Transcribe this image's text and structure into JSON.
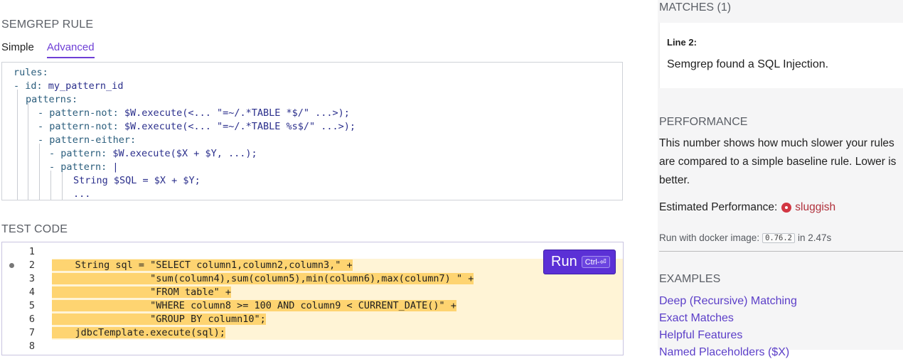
{
  "rule_section": {
    "title": "SEMGREP RULE",
    "tabs": [
      {
        "label": "Simple",
        "active": false
      },
      {
        "label": "Advanced",
        "active": true
      }
    ],
    "yaml_lines": [
      {
        "key": "rules:",
        "val": ""
      },
      {
        "key": "- id: ",
        "val": "my_pattern_id"
      },
      {
        "key": "patterns:",
        "val": ""
      },
      {
        "key": "- pattern-not: ",
        "val": "$W.execute(<... \"=~/.*TABLE *$/\" ...>);"
      },
      {
        "key": "- pattern-not: ",
        "val": "$W.execute(<... \"=~/.*TABLE %s$/\" ...>);"
      },
      {
        "key": "- pattern-either:",
        "val": ""
      },
      {
        "key": "- pattern: ",
        "val": "$W.execute($X + $Y, ...);"
      },
      {
        "key": "- pattern: ",
        "val": "|"
      },
      {
        "key": "",
        "val": "String $SQL = $X + $Y;"
      },
      {
        "key": "",
        "val": "..."
      }
    ]
  },
  "test_section": {
    "title": "TEST CODE",
    "run_button": {
      "label": "Run",
      "shortcut": "Ctrl-⏎"
    },
    "lines": [
      {
        "num": "1",
        "code": "",
        "highlight": false,
        "dot": false
      },
      {
        "num": "2",
        "code": "    String sql = \"SELECT column1,column2,column3,\" +",
        "highlight": true,
        "dot": true
      },
      {
        "num": "3",
        "code": "                 \"sum(column4),sum(column5),min(column6),max(column7) \" +",
        "highlight": true,
        "dot": false
      },
      {
        "num": "4",
        "code": "                 \"FROM table\" +",
        "highlight": true,
        "dot": false
      },
      {
        "num": "5",
        "code": "                 \"WHERE column8 >= 100 AND column9 < CURRENT_DATE()\" +",
        "highlight": true,
        "dot": false
      },
      {
        "num": "6",
        "code": "                 \"GROUP BY column10\";",
        "highlight": true,
        "dot": false
      },
      {
        "num": "7",
        "code": "    jdbcTemplate.execute(sql);",
        "highlight": true,
        "dot": false
      },
      {
        "num": "8",
        "code": "",
        "highlight": false,
        "dot": false
      }
    ]
  },
  "matches": {
    "title": "MATCHES (1)",
    "items": [
      {
        "line": "Line 2:",
        "message": "Semgrep found a SQL Injection."
      }
    ]
  },
  "performance": {
    "title": "PERFORMANCE",
    "description": "This number shows how much slower your rules are compared to a simple baseline rule. Lower is better.",
    "estimated_label": "Estimated Performance:",
    "estimated_value": "sluggish",
    "estimated_icon": "sluggish-icon",
    "status_color": "#d23743",
    "docker_prefix": "Run with docker image:",
    "docker_version": "0.76.2",
    "docker_time": "in 2.47s"
  },
  "examples": {
    "title": "EXAMPLES",
    "links": [
      "Deep (Recursive) Matching",
      "Exact Matches",
      "Helpful Features",
      "Named Placeholders ($X)"
    ]
  },
  "colors": {
    "accent": "#5b30d6",
    "link": "#5b3ec8",
    "match_highlight": "#fed471"
  }
}
